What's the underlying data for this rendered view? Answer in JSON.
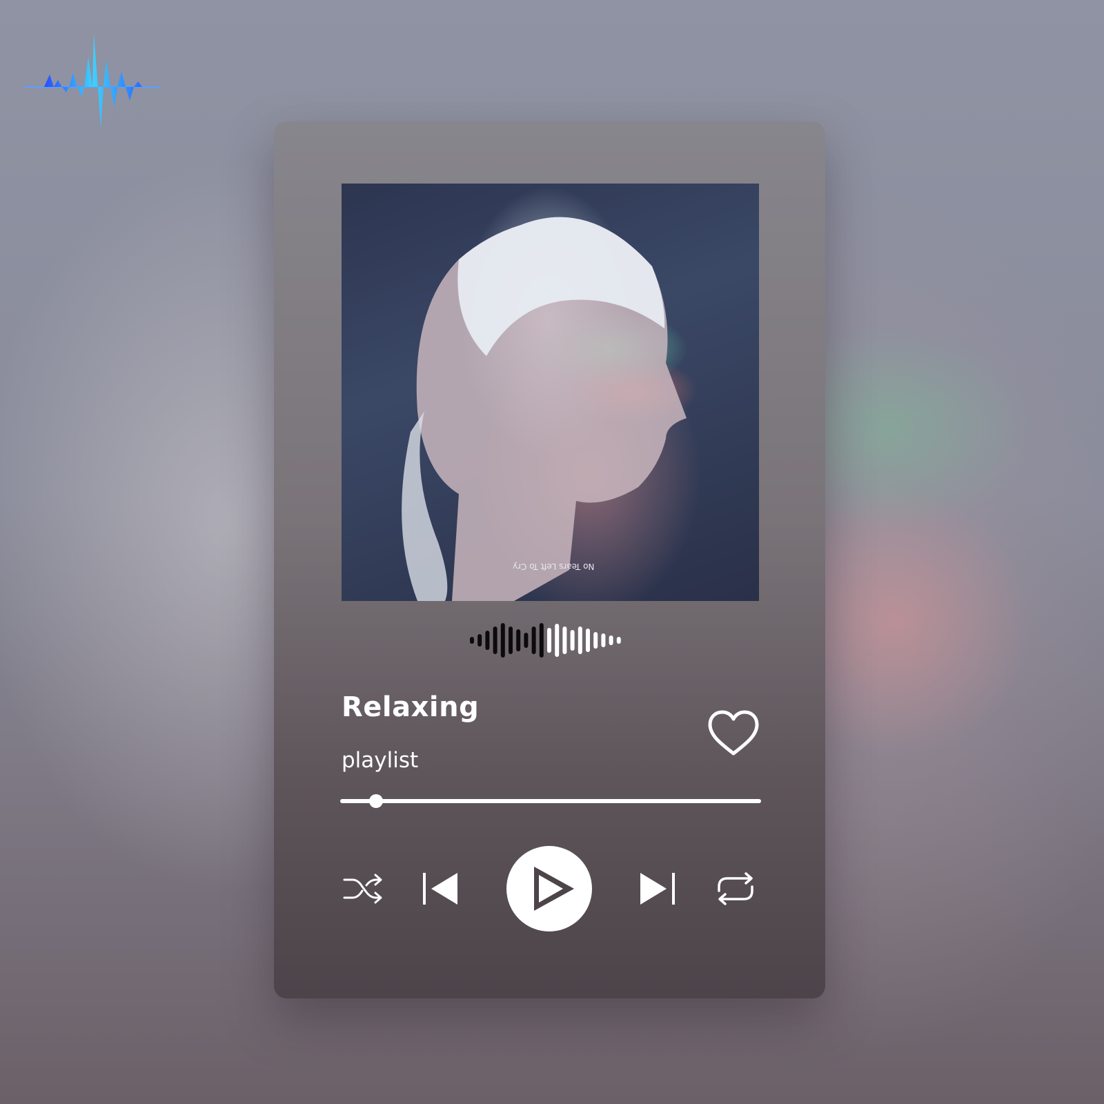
{
  "player": {
    "title": "Relaxing",
    "subtitle": "playlist",
    "album_caption": "No Tears Left To Cry",
    "progress": 0.086,
    "liked": false
  },
  "icons": {
    "logo": "soundwave-logo-icon",
    "like": "heart-icon",
    "shuffle": "shuffle-icon",
    "previous": "skip-previous-icon",
    "play": "play-icon",
    "next": "skip-next-icon",
    "repeat": "repeat-icon"
  },
  "colors": {
    "accent": "#ffffff",
    "logo_cyan": "#3fd0ff",
    "logo_blue": "#2a4cff"
  }
}
